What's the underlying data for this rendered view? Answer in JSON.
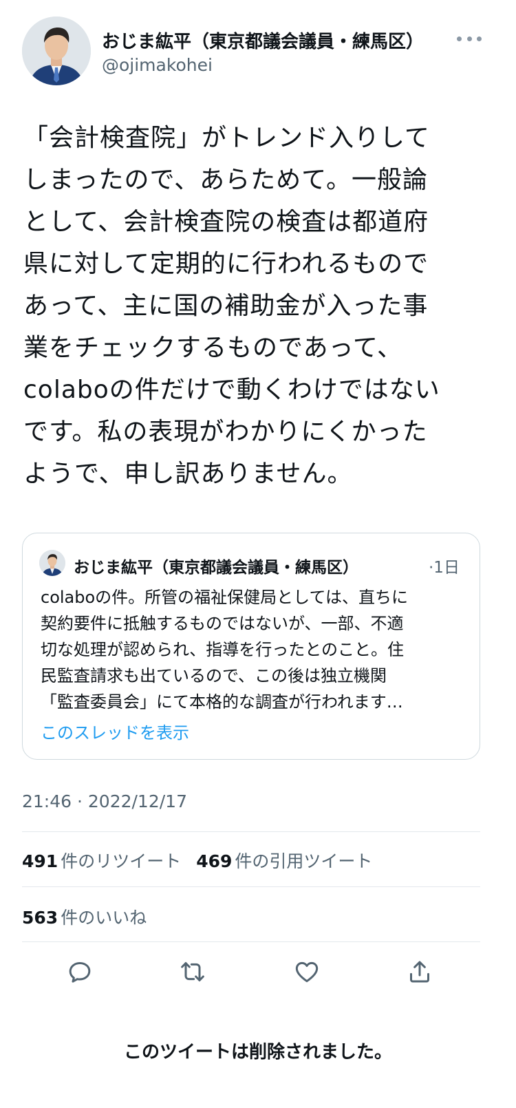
{
  "author": {
    "name": "おじま紘平（東京都議会議員・練馬区）",
    "handle": "@ojimakohei"
  },
  "tweet": {
    "lines": [
      "「会計検査院」がトレンド入りして",
      "しまったので、あらためて。一般論",
      "として、会計検査院の検査は都道府",
      "県に対して定期的に行われるもので",
      "あって、主に国の補助金が入った事",
      "業をチェックするものであって、",
      "colaboの件だけで動くわけではない",
      "です。私の表現がわかりにくかった",
      "ようで、申し訳ありません。"
    ]
  },
  "quote": {
    "name": "おじま紘平（東京都議会議員・練馬区）",
    "time": "·1日",
    "lines": [
      "colaboの件。所管の福祉保健局としては、直ちに",
      "契約要件に抵触するものではないが、一部、不適",
      "切な処理が認められ、指導を行ったとのこと。住",
      "民監査請求も出ているので、この後は独立機関",
      "「監査委員会」にて本格的な調査が行われます…"
    ],
    "show_thread": "このスレッドを表示"
  },
  "timestamp": "21:46 · 2022/12/17",
  "stats": {
    "retweets_count": "491",
    "retweets_label": "件のリツイート",
    "quotes_count": "469",
    "quotes_label": "件の引用ツイート",
    "likes_count": "563",
    "likes_label": "件のいいね"
  },
  "actions": {
    "reply": "reply-icon",
    "retweet": "retweet-icon",
    "like": "heart-icon",
    "share": "share-icon"
  },
  "notice": "このツイートは削除されました。",
  "colors": {
    "text": "#0f1419",
    "secondary": "#536471",
    "link": "#1d9bf0",
    "border": "#cfd9de"
  }
}
